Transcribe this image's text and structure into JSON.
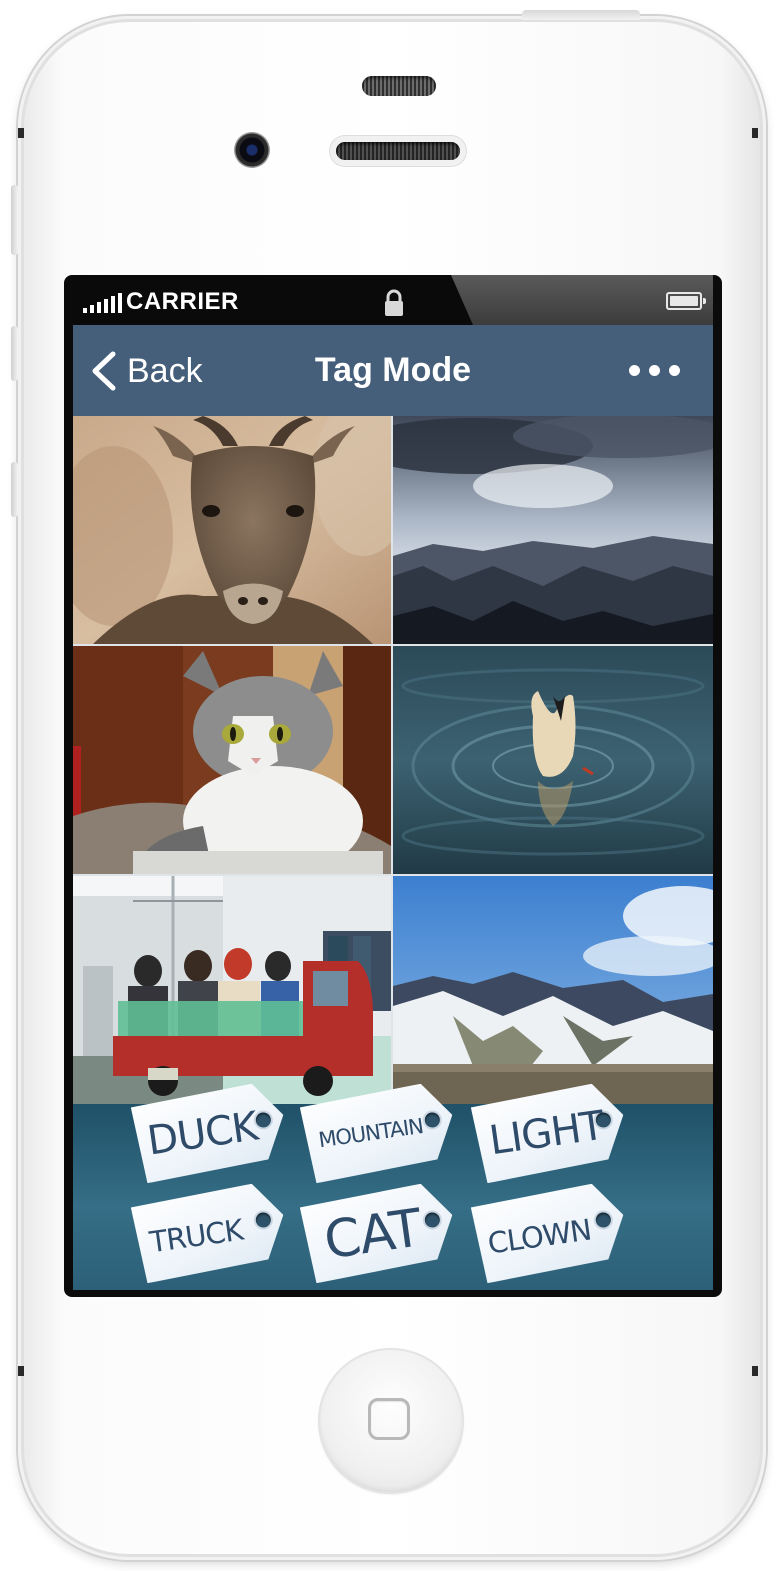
{
  "status_bar": {
    "carrier": "CARRIER"
  },
  "nav": {
    "back_label": "Back",
    "title": "Tag Mode",
    "more_icon": "more-horizontal-icon"
  },
  "photos": [
    {
      "subject": "goat"
    },
    {
      "subject": "canyon"
    },
    {
      "subject": "cat"
    },
    {
      "subject": "duck"
    },
    {
      "subject": "truck"
    },
    {
      "subject": "mountain"
    }
  ],
  "tags": [
    {
      "label": "DUCK"
    },
    {
      "label": "MOUNTAIN"
    },
    {
      "label": "LIGHT"
    },
    {
      "label": "TRUCK"
    },
    {
      "label": "CAT"
    },
    {
      "label": "CLOWN"
    }
  ],
  "colors": {
    "navbar": "#455f7b",
    "tray": "#2c6078",
    "tag_text": "#2f4b6a"
  }
}
